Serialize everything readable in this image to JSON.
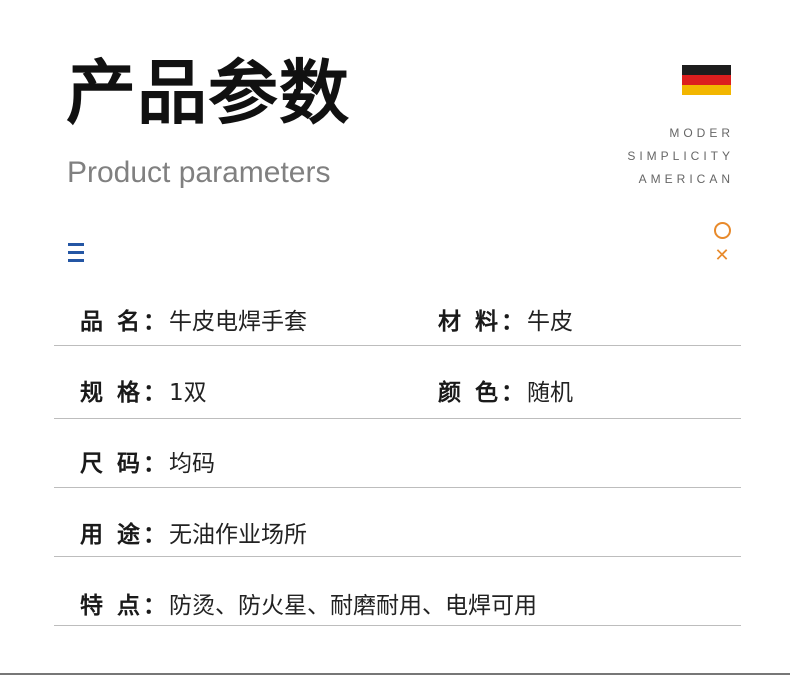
{
  "header": {
    "title_cn": "产品参数",
    "title_en": "Product parameters",
    "tagline": [
      "MODER",
      "SIMPLICITY",
      "AMERICAN"
    ],
    "flag_colors": [
      "#1d1d1d",
      "#dc1e1e",
      "#f2b600"
    ]
  },
  "decor": {
    "menu_icon": "menu-icon",
    "circle_icon": "circle-icon",
    "close_icon": "close-icon",
    "accent_color": "#e88a2b",
    "menu_color": "#2456a4"
  },
  "params": [
    {
      "label": "品 名：",
      "value": "牛皮电焊手套",
      "label2": "材 料：",
      "value2": "牛皮"
    },
    {
      "label": "规 格：",
      "value": "1双",
      "label2": "颜 色：",
      "value2": "随机"
    },
    {
      "label": "尺 码：",
      "value": "均码"
    },
    {
      "label": "用 途：",
      "value": "无油作业场所"
    },
    {
      "label": "特 点：",
      "value": "防烫、防火星、耐磨耐用、电焊可用"
    }
  ]
}
